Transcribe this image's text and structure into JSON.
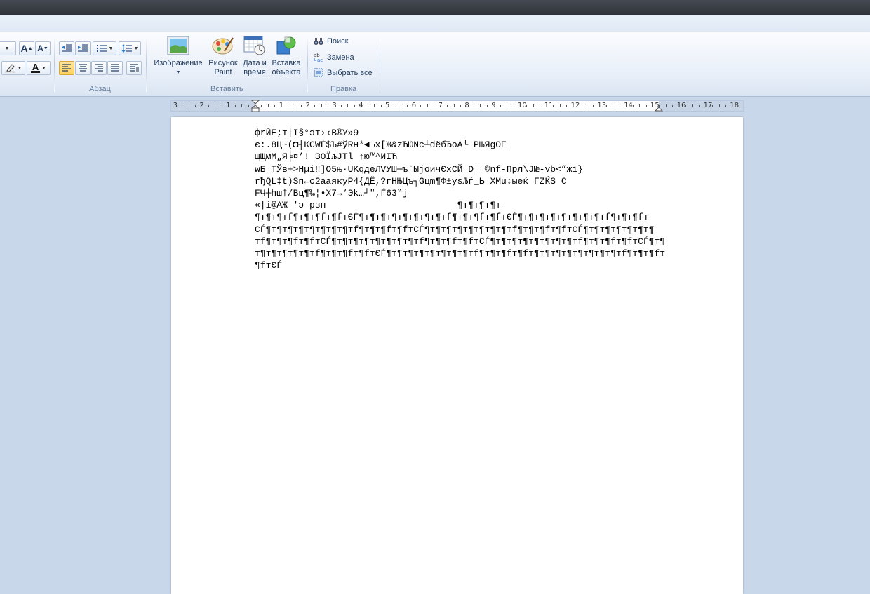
{
  "ribbon": {
    "groups": {
      "paragraph": "Абзац",
      "insert": "Вставить",
      "edit": "Правка"
    },
    "font_buttons": {
      "grow_font": "A",
      "shrink_font": "A",
      "font_color": "A"
    },
    "insert_buttons": {
      "image": "Изображение",
      "paint_line1": "Рисунок",
      "paint_line2": "Paint",
      "datetime_line1": "Дата и",
      "datetime_line2": "время",
      "object_line1": "Вставка",
      "object_line2": "объекта"
    },
    "edit_buttons": {
      "find": "Поиск",
      "replace": "Замена",
      "select_all": "Выбрать все"
    },
    "colors": {
      "accent_active": "#ffd35c",
      "font_color_bar": "#1a1a1a"
    }
  },
  "ruler": {
    "labels": [
      "3",
      "2",
      "1",
      "",
      "1",
      "2",
      "3",
      "4",
      "5",
      "6",
      "7",
      "8",
      "9",
      "10",
      "11",
      "12",
      "13",
      "14",
      "15",
      "16",
      "17",
      "18"
    ]
  },
  "document": {
    "lines": [
      "фrЙЕ;т|I§°эт›‹В®У»9",
      "є:.8Ц~(◘┤КЄWЃ$Ъ#ўRн*◄¬х[Ж&zЋЮNс┴dёбЂоА└ РЊЯgОЕ",
      "щЩмМ„Я╞¤’! ЗОЇљЈТl ↑ю™^ИІЋ",
      "wБ ТЎв+>Нµі‼]О5њ·UKqдеЛVУШ─ъ`ЫјоичЄхСЙ D =©nf-Прл\\Ј№-vb<”жї}",
      "rђQL‡t)Sп←с2аaякуР4{ДЁ,?гНЊЦъ┐Gцm¶Ф±уsЉѓ_Ь ХМu↨ыеќ ГZЌS С",
      "FЧ┼hш†/Вц¶‰¦•Х7→‘Эk…┘\",Ѓ63‟j",
      "«|i@АЖ 'э-рзп                        ¶т¶т¶т¶т",
      "¶т¶т¶тf¶т¶т¶fт¶fтЄЃ¶т¶т¶т¶т¶т¶т¶т¶тf¶т¶т¶fт¶fтЄЃ¶т¶т¶т¶т¶т¶т¶т¶тf¶т¶т¶fт",
      "ЄЃ¶т¶т¶т¶т¶т¶т¶т¶тf¶т¶т¶fт¶fтЄЃ¶т¶т¶т¶т¶т¶т¶т¶тf¶т¶т¶fт¶fтЄЃ¶т¶т¶т¶т¶т¶т¶",
      "тf¶т¶т¶fт¶fтЄЃ¶т¶т¶т¶т¶т¶т¶т¶тf¶т¶т¶fт¶fтЄЃ¶т¶т¶т¶т¶т¶т¶т¶тf¶т¶т¶fт¶fтЄЃ¶т¶",
      "т¶т¶т¶т¶т¶тf¶т¶т¶fт¶fтЄЃ¶т¶т¶т¶т¶т¶т¶т¶тf¶т¶т¶fт¶fт¶т¶т¶т¶т¶т¶т¶т¶тf¶т¶т¶fт",
      "¶fтЄЃ"
    ]
  }
}
